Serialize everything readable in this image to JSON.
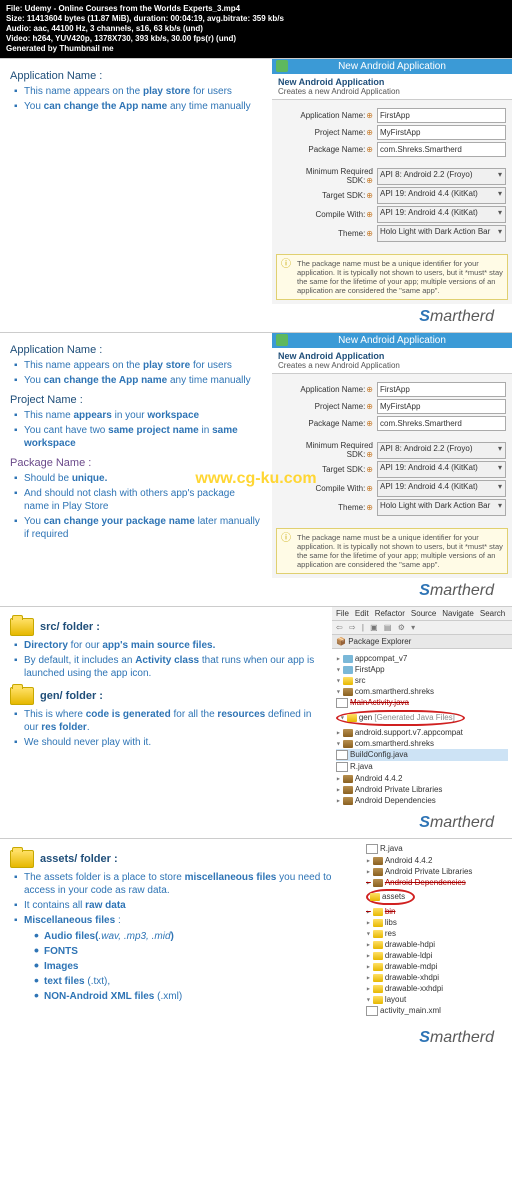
{
  "header": {
    "l1": "File: Udemy - Online Courses from the Worlds Experts_3.mp4",
    "l2": "Size: 11413604 bytes (11.87 MiB), duration: 00:04:19, avg.bitrate: 359 kb/s",
    "l3": "Audio: aac, 44100 Hz, 3 channels, s16, 63 kb/s (und)",
    "l4": "Video: h264, YUV420p, 1378X730, 393 kb/s, 30.00 fps(r) (und)",
    "l5": "Generated by Thumbnail me"
  },
  "s1": {
    "title": "Application Name :",
    "b1a": "This name appears on the ",
    "b1b": "play store",
    "b1c": " for users",
    "b2a": "You ",
    "b2b": "can change the App name",
    "b2c": " any time manually"
  },
  "dlg": {
    "title": "New Android Application",
    "sub1": "New Android Application",
    "sub2": "Creates a new Android Application",
    "f_app": "Application Name:",
    "f_proj": "Project Name:",
    "f_pkg": "Package Name:",
    "f_min": "Minimum Required SDK:",
    "f_tgt": "Target SDK:",
    "f_cmp": "Compile With:",
    "f_thm": "Theme:",
    "v_app": "FirstApp",
    "v_proj": "MyFirstApp",
    "v_pkg": "com.Shreks.Smartherd",
    "v_min": "API 8: Android 2.2 (Froyo)",
    "v_tgt": "API 19: Android 4.4 (KitKat)",
    "v_cmp": "API 19: Android 4.4 (KitKat)",
    "v_thm": "Holo Light with Dark Action Bar",
    "info": "The package name must be a unique identifier for your application. It is typically not shown to users, but it *must* stay the same for the lifetime of your app; multiple versions of an application are considered the \"same app\"."
  },
  "brand": {
    "s": "S",
    "rest": "martherd"
  },
  "s2": {
    "proj_t": "Project Name :",
    "p1a": "This name ",
    "p1b": "appears",
    "p1c": " in your ",
    "p1d": "workspace",
    "p2a": "You cant have two ",
    "p2b": "same project name",
    "p2c": " in ",
    "p2d": "same workspace",
    "pkg_t": "Package Name :",
    "k1a": "Should be ",
    "k1b": "unique.",
    "k2": "And should not clash with others app's package name in Play Store",
    "k3a": "You ",
    "k3b": "can change your package name",
    "k3c": " later manually if required"
  },
  "wm": "www.cg-ku.com",
  "s3": {
    "src_t": "src/ folder :",
    "s1a": "Directory",
    "s1b": " for our ",
    "s1c": "app's main source files.",
    "s2a": "By default,  it includes an ",
    "s2b": "Activity class",
    "s2c": " that runs when our app is launched using the app icon.",
    "gen_t": "gen/ folder :",
    "g1a": "This is where ",
    "g1b": "code is generated",
    "g1c": " for all the ",
    "g1d": "resources",
    "g1e": " defined in our ",
    "g1f": "res folder",
    "g1g": ".",
    "g2": "We should never play with it."
  },
  "ide": {
    "menu": {
      "m1": "File",
      "m2": "Edit",
      "m3": "Refactor",
      "m4": "Source",
      "m5": "Navigate",
      "m6": "Search"
    },
    "pe": "Package Explorer",
    "tb": "⇦ ⇨ | ▣ ▤ ⚙ ▾",
    "n1": "appcompat_v7",
    "n2": "FirstApp",
    "n3": "src",
    "n4": "com.smartherd.shreks",
    "n5": "MainActivity.java",
    "n6a": "gen ",
    "n6b": "[Generated Java Files]",
    "n7": "android.support.v7.appcompat",
    "n8": "com.smartherd.shreks",
    "n9": "BuildConfig.java",
    "n10": "R.java",
    "n11": "Android 4.4.2",
    "n12": "Android Private Libraries",
    "n13": "Android Dependencies"
  },
  "s4": {
    "t": "assets/ folder :",
    "a1a": "The assets folder is a place to store ",
    "a1b": "miscellaneous files",
    "a1c": " you need to access in your code as raw data.",
    "a2a": "It contains all ",
    "a2b": "raw data",
    "a3a": "Miscellaneous files ",
    "a3b": ":",
    "m1a": "Audio files(",
    "m1b": ".wav, .mp3, .mid",
    "m1c": ")",
    "m2": "FONTS",
    "m3": "Images",
    "m4a": "text files ",
    "m4b": "(.txt),",
    "m5a": "NON-Android XML files ",
    "m5b": "(.xml)"
  },
  "tree2": {
    "n0": "R.java",
    "n1": "Android 4.4.2",
    "n2": "Android Private Libraries",
    "n3": "Android Dependencies",
    "n4": "assets",
    "n5": "bin",
    "n6": "libs",
    "n7": "res",
    "n8": "drawable-hdpi",
    "n9": "drawable-ldpi",
    "n10": "drawable-mdpi",
    "n11": "drawable-xhdpi",
    "n12": "drawable-xxhdpi",
    "n13": "layout",
    "n14": "activity_main.xml"
  }
}
